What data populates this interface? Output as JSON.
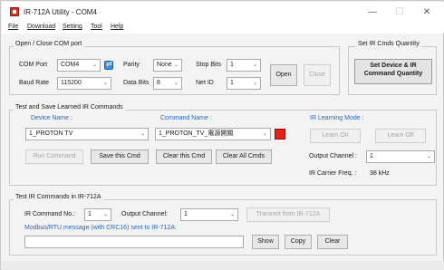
{
  "window": {
    "title": "IR-712A Utility - COM4",
    "min_glyph": "—",
    "max_glyph": "☐",
    "close_glyph": "✕"
  },
  "menu": [
    "File",
    "Download",
    "Setting",
    "Tool",
    "Help"
  ],
  "com_group": {
    "title": "Open / Close COM port",
    "com_port_label": "COM Port",
    "com_port_value": "COM4",
    "parity_label": "Parity",
    "parity_value": "None",
    "stop_bits_label": "Stop Bits",
    "stop_bits_value": "1",
    "baud_label": "Baud Rate",
    "baud_value": "115200",
    "data_bits_label": "Data Bits",
    "data_bits_value": "8",
    "net_id_label": "Net ID",
    "net_id_value": "1",
    "open_label": "Open",
    "close_label": "Close"
  },
  "qty_group": {
    "title": "Set IR Cmds Quantity",
    "button_line1": "Set Device & IR",
    "button_line2": "Command Quantity"
  },
  "learn_group": {
    "title": "Test and Save Learned IR Commands",
    "device_name_label": "Device Name :",
    "device_name_value": "1_PROTON TV",
    "command_name_label": "Command Name :",
    "command_name_value": "1_PROTON_TV_電源開關",
    "learning_mode_label": "IR Learning Mode :",
    "learn_on": "Learn On",
    "learn_off": "Learn Off",
    "run_command": "Run Command",
    "save_cmd": "Save this Cmd",
    "clear_cmd": "Clear this Cmd",
    "clear_all": "Clear All Cmds",
    "output_channel_label": "Output Channel :",
    "output_channel_value": "1",
    "carrier_label": "IR Carrier Freq. :",
    "carrier_value": "38 kHz",
    "swatch_color": "#e0241a"
  },
  "test_group": {
    "title": "Test IR Commands in IR-712A",
    "cmd_no_label": "IR Command No.:",
    "cmd_no_value": "1",
    "out_ch_label": "Output Channel:",
    "out_ch_value": "1",
    "transmit_label": "Transmit from IR-712A",
    "modbus_label": "Modbus/RTU message (with CRC16) sent to IR-712A:",
    "message_value": "",
    "show_label": "Show",
    "copy_label": "Copy",
    "clear_label": "Clear"
  },
  "chevron": "⌄"
}
